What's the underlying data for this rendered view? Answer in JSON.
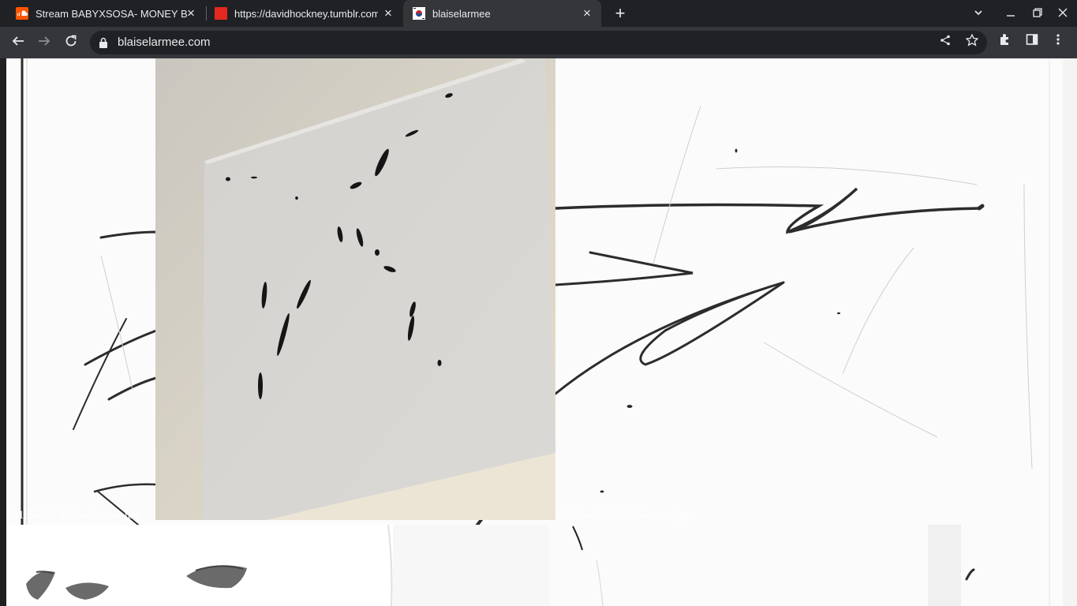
{
  "browser": {
    "tabs": [
      {
        "title": "Stream BABYXSOSA- MONEY BA",
        "favicon": "soundcloud-icon",
        "active": false
      },
      {
        "title": "https://davidhockney.tumblr.com",
        "favicon": "tumblr-icon",
        "active": false
      },
      {
        "title": "blaiselarmee",
        "favicon": "site-favicon-icon",
        "active": true
      }
    ],
    "new_tab_icon": "plus-icon",
    "window_controls": [
      "tab-search-icon",
      "minimize-icon",
      "restore-icon",
      "close-icon"
    ],
    "nav": {
      "back_icon": "arrow-left-icon",
      "forward_icon": "arrow-right-icon",
      "reload_icon": "reload-icon"
    },
    "address": {
      "url": "blaiselarmee.com",
      "lock_icon": "lock-icon",
      "share_icon": "share-icon",
      "bookmark_icon": "star-icon"
    },
    "toolbar_icons": [
      "extensions-icon",
      "side-panel-icon",
      "menu-icon"
    ]
  },
  "page": {
    "images": [
      {
        "caption": "2018/w-07-blaiselarmee.jpg"
      },
      {
        "caption": "2018/w-08-blaiselarmee.jpg"
      }
    ]
  },
  "colors": {
    "chrome_dark": "#202124",
    "chrome_toolbar": "#35363a",
    "chrome_text": "#e8eaed",
    "ink": "#1e1e1e",
    "paper": "#d6d4cf"
  }
}
